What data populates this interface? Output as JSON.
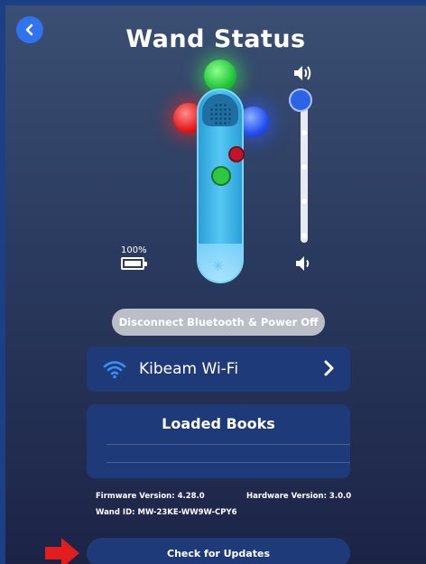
{
  "header": {
    "title": "Wand Status"
  },
  "battery": {
    "percent_label": "100%",
    "level": 1.0
  },
  "volume": {
    "level": 1.0
  },
  "actions": {
    "disconnect_label": "Disconnect Bluetooth & Power Off"
  },
  "wifi": {
    "label": "Kibeam Wi-Fi"
  },
  "books": {
    "title": "Loaded Books"
  },
  "device_info": {
    "firmware": "Firmware Version: 4.28.0",
    "hardware": "Hardware Version: 3.0.0",
    "wand_id": "Wand ID: MW-23KE-WW9W-CPY6"
  },
  "updates": {
    "button_label": "Check for Updates"
  },
  "icons": [
    "back-arrow-icon",
    "speaker-high-icon",
    "speaker-low-icon",
    "battery-icon",
    "wifi-icon",
    "chevron-right-icon",
    "red-arrow-icon"
  ],
  "colors": {
    "accent": "#2f74ee",
    "panel": "#1f3a78",
    "background": "#2a3a5e"
  }
}
